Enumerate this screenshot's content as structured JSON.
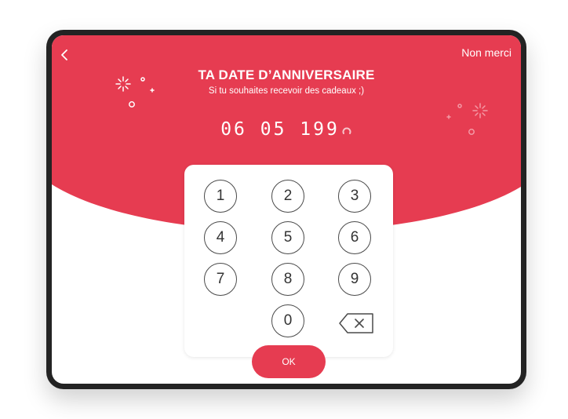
{
  "header": {
    "back_icon": "chevron-left-icon",
    "skip_label": "Non merci"
  },
  "prompt": {
    "title": "TA DATE D’ANNIVERSAIRE",
    "subtitle": "Si tu souhaites recevoir des cadeaux ;)"
  },
  "date_input": {
    "value": "06 05 199",
    "cursor_icon": "loading-spinner-icon"
  },
  "keypad": {
    "keys": [
      "1",
      "2",
      "3",
      "4",
      "5",
      "6",
      "7",
      "8",
      "9",
      "0"
    ],
    "backspace_icon": "backspace-icon"
  },
  "actions": {
    "ok_label": "OK"
  },
  "colors": {
    "accent": "#e63c51",
    "device_frame": "#232323",
    "background": "#ffffff"
  }
}
